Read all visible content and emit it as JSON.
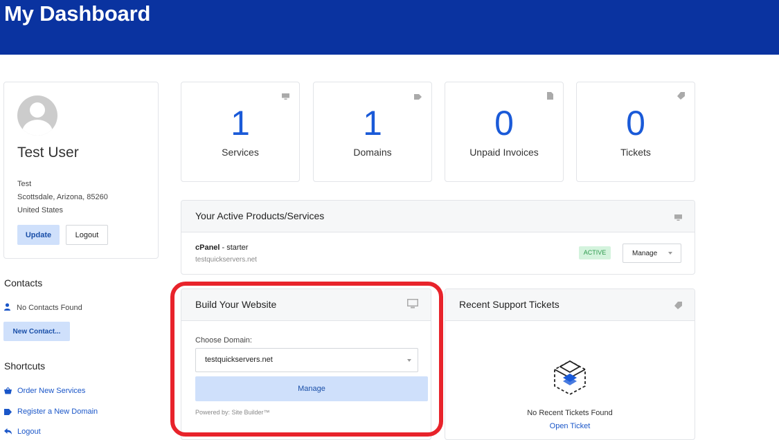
{
  "header": {
    "title": "My Dashboard"
  },
  "profile": {
    "name": "Test User",
    "company": "Test",
    "city_line": "Scottsdale, Arizona, 85260",
    "country": "United States",
    "update_label": "Update",
    "logout_label": "Logout"
  },
  "contacts": {
    "title": "Contacts",
    "empty_text": "No Contacts Found",
    "new_label": "New Contact..."
  },
  "shortcuts": {
    "title": "Shortcuts",
    "items": [
      {
        "label": "Order New Services",
        "icon": "basket-icon"
      },
      {
        "label": "Register a New Domain",
        "icon": "tag-icon"
      },
      {
        "label": "Logout",
        "icon": "arrow-left-icon"
      }
    ]
  },
  "stats": [
    {
      "value": "1",
      "label": "Services",
      "icon": "monitor-icon"
    },
    {
      "value": "1",
      "label": "Domains",
      "icon": "tag-icon"
    },
    {
      "value": "0",
      "label": "Unpaid Invoices",
      "icon": "document-icon"
    },
    {
      "value": "0",
      "label": "Tickets",
      "icon": "ticket-icon"
    }
  ],
  "products": {
    "title": "Your Active Products/Services",
    "item": {
      "product": "cPanel",
      "separator": " - ",
      "plan": "starter",
      "domain": "testquickservers.net",
      "status": "ACTIVE",
      "manage_label": "Manage"
    }
  },
  "builder": {
    "title": "Build Your Website",
    "choose_label": "Choose Domain:",
    "selected_domain": "testquickservers.net",
    "manage_label": "Manage",
    "powered_by": "Powered by: Site Builder™"
  },
  "tickets": {
    "title": "Recent Support Tickets",
    "empty_text": "No Recent Tickets Found",
    "open_label": "Open Ticket"
  },
  "colors": {
    "header_bg": "#0a33a0",
    "accent": "#1a5ad8",
    "highlight": "#e8232b",
    "active_badge": "#d4f3dd"
  }
}
